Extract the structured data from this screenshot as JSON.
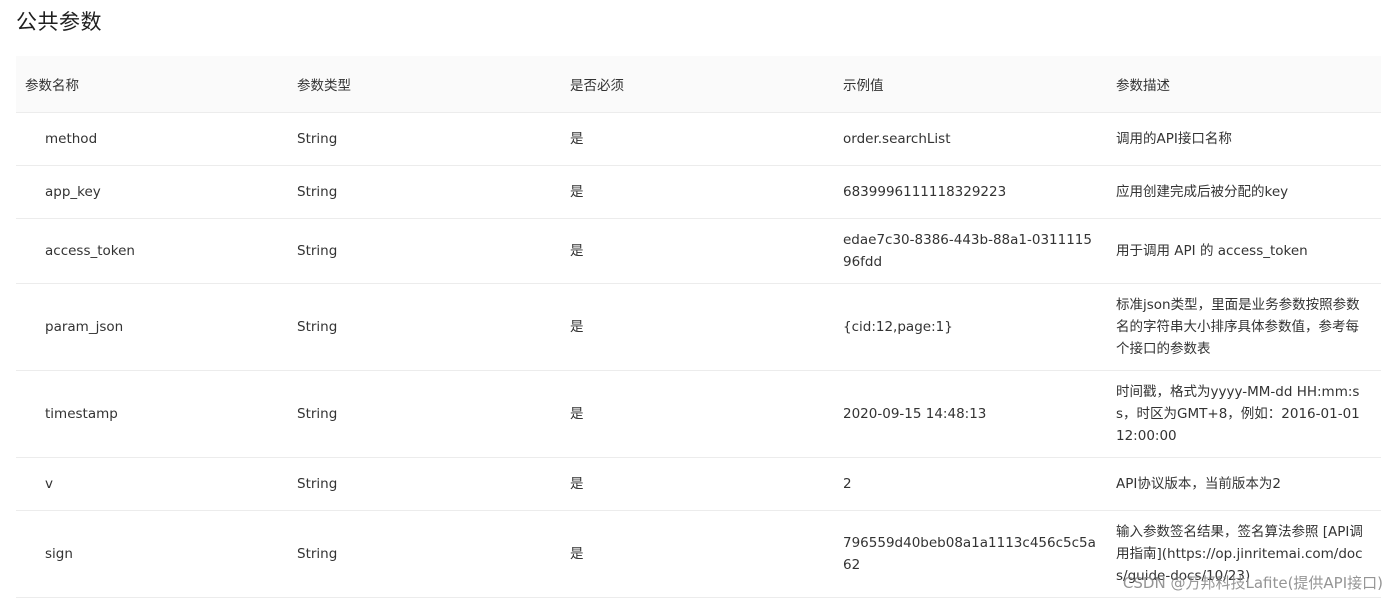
{
  "title": "公共参数",
  "table": {
    "headers": [
      "参数名称",
      "参数类型",
      "是否必须",
      "示例值",
      "参数描述"
    ],
    "rows": [
      {
        "name": "method",
        "type": "String",
        "required": "是",
        "example": "order.searchList",
        "desc": "调用的API接口名称"
      },
      {
        "name": "app_key",
        "type": "String",
        "required": "是",
        "example": "6839996111118329223",
        "desc": "应用创建完成后被分配的key"
      },
      {
        "name": "access_token",
        "type": "String",
        "required": "是",
        "example": "edae7c30-8386-443b-88a1-031111596fdd",
        "desc": "用于调用 API 的 access_token"
      },
      {
        "name": "param_json",
        "type": "String",
        "required": "是",
        "example": "{cid:12,page:1}",
        "desc": "标准json类型，里面是业务参数按照参数名的字符串大小排序具体参数值，参考每个接口的参数表"
      },
      {
        "name": "timestamp",
        "type": "String",
        "required": "是",
        "example": "2020-09-15 14:48:13",
        "desc": "时间戳，格式为yyyy-MM-dd HH:mm:ss，时区为GMT+8，例如：2016-01-01 12:00:00"
      },
      {
        "name": "v",
        "type": "String",
        "required": "是",
        "example": "2",
        "desc": "API协议版本，当前版本为2"
      },
      {
        "name": "sign",
        "type": "String",
        "required": "是",
        "example": "796559d40beb08a1a1113c456c5c5a62",
        "desc": "输入参数签名结果，签名算法参照 [API调用指南](https://op.jinritemai.com/docs/guide-docs/10/23)"
      }
    ]
  },
  "watermark": "CSDN @万邦科技Lafite(提供API接口)"
}
